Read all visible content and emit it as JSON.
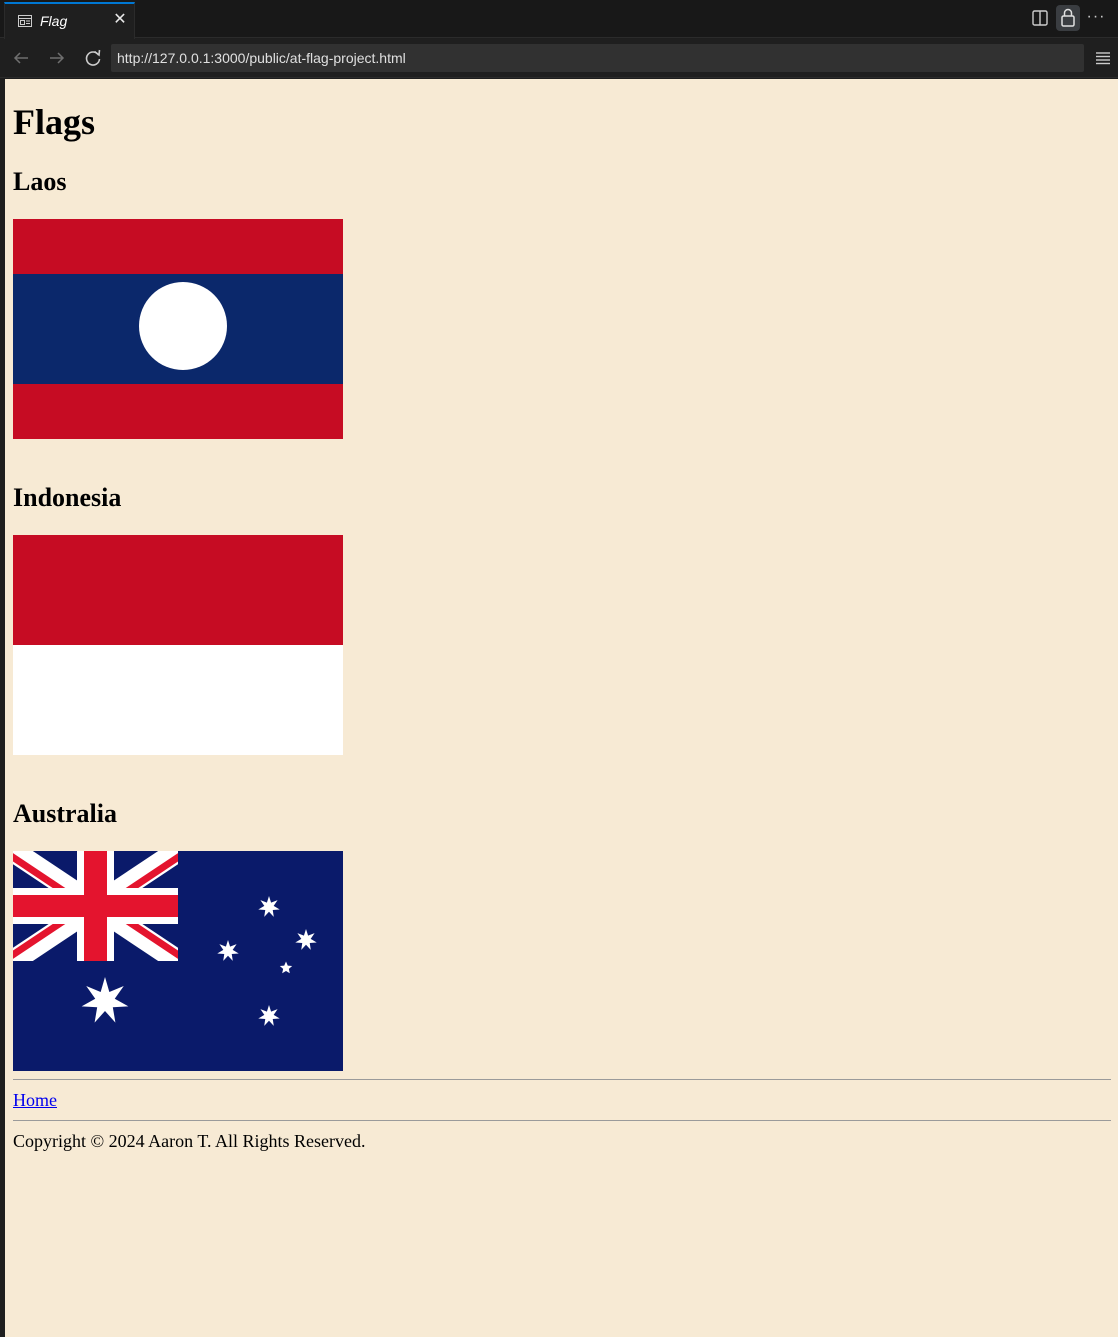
{
  "browser": {
    "tab_title": "Flag",
    "tab_close": "✕",
    "more_label": "···",
    "url": "http://127.0.0.1:3000/public/at-flag-project.html"
  },
  "page": {
    "heading": "Flags",
    "flags": [
      {
        "country": "Laos",
        "colors": {
          "red": "#c60c23",
          "blue": "#0b286b",
          "disc": "#ffffff"
        }
      },
      {
        "country": "Indonesia",
        "colors": {
          "top": "#c60c23",
          "bottom": "#ffffff"
        }
      },
      {
        "country": "Australia",
        "colors": {
          "field": "#0a1a6a",
          "red": "#e4142e",
          "white": "#ffffff"
        }
      }
    ],
    "footer": {
      "home_link": "Home",
      "copyright": "Copyright © 2024 Aaron T. All Rights Reserved."
    }
  }
}
